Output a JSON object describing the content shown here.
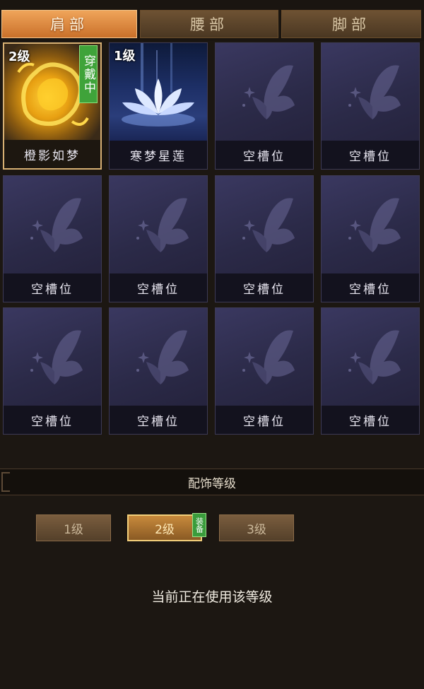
{
  "tabs": [
    {
      "label": "肩部",
      "active": true
    },
    {
      "label": "腰部",
      "active": false
    },
    {
      "label": "脚部",
      "active": false
    }
  ],
  "slots": [
    {
      "name": "橙影如梦",
      "level": "2级",
      "tag": "穿戴中",
      "type": "fire-orb",
      "selected": true
    },
    {
      "name": "寒梦星莲",
      "level": "1级",
      "tag": "",
      "type": "lotus",
      "selected": false
    },
    {
      "name": "空槽位",
      "type": "empty"
    },
    {
      "name": "空槽位",
      "type": "empty"
    },
    {
      "name": "空槽位",
      "type": "empty"
    },
    {
      "name": "空槽位",
      "type": "empty"
    },
    {
      "name": "空槽位",
      "type": "empty"
    },
    {
      "name": "空槽位",
      "type": "empty"
    },
    {
      "name": "空槽位",
      "type": "empty"
    },
    {
      "name": "空槽位",
      "type": "empty"
    },
    {
      "name": "空槽位",
      "type": "empty"
    },
    {
      "name": "空槽位",
      "type": "empty"
    }
  ],
  "section": {
    "title": "配饰等级"
  },
  "levels": [
    {
      "label": "1级",
      "active": false
    },
    {
      "label": "2级",
      "active": true,
      "tag": "装备"
    },
    {
      "label": "3级",
      "active": false
    }
  ],
  "status_text": "当前正在使用该等级",
  "colors": {
    "accent": "#f0a55a",
    "wear_tag": "#3fa33a",
    "slot_bg": "#2a2840"
  }
}
